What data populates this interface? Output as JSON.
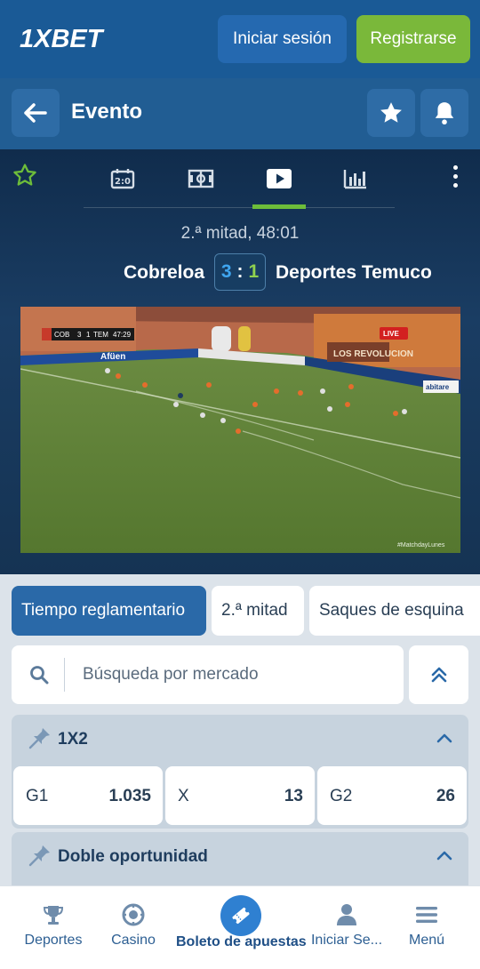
{
  "header": {
    "logo_text": "1XBET",
    "login_label": "Iniciar sesión",
    "register_label": "Registrarse"
  },
  "subheader": {
    "title": "Evento"
  },
  "event": {
    "tabs": [
      {
        "name": "scoreboard",
        "icon": "scoreboard-icon"
      },
      {
        "name": "field",
        "icon": "field-icon"
      },
      {
        "name": "video",
        "icon": "play-icon",
        "active": true
      },
      {
        "name": "stats",
        "icon": "stats-icon"
      }
    ],
    "period": "2.ª mitad, 48:01",
    "home_team": "Cobreloa",
    "away_team": "Deportes Temuco",
    "score_home": "3",
    "score_sep": ":",
    "score_away": "1",
    "video": {
      "scorebug_home": "COB",
      "scorebug_home_score": "3",
      "scorebug_away_score": "1",
      "scorebug_away": "TEM",
      "scorebug_time": "47:29",
      "live_badge": "LIVE",
      "watermark": "#MatchdayLunes"
    }
  },
  "period_tabs": [
    {
      "label": "Tiempo reglamentario",
      "active": true
    },
    {
      "label": "2.ª mitad",
      "active": false
    },
    {
      "label": "Saques de esquina",
      "active": false
    }
  ],
  "search": {
    "placeholder": "Búsqueda por mercado"
  },
  "markets": [
    {
      "title": "1X2",
      "odds": [
        {
          "label": "G1",
          "value": "1.035"
        },
        {
          "label": "X",
          "value": "13"
        },
        {
          "label": "G2",
          "value": "26"
        }
      ]
    },
    {
      "title": "Doble oportunidad"
    }
  ],
  "bottom_nav": {
    "items": [
      {
        "label": "Deportes",
        "icon": "trophy-icon"
      },
      {
        "label": "Casino",
        "icon": "casino-chip-icon"
      },
      {
        "label": "Boleto de apuestas",
        "icon": "ticket-icon"
      },
      {
        "label": "Iniciar Se...",
        "icon": "user-icon"
      },
      {
        "label": "Menú",
        "icon": "menu-icon"
      }
    ]
  },
  "colors": {
    "header_bg": "#1a5a96",
    "subheader_bg": "#215d93",
    "register_green": "#7ab83a",
    "active_tab_blue": "#2a69a8",
    "score_home": "#3fa6f0",
    "score_away": "#8fd14f",
    "nav_blue": "#2d5f93"
  }
}
